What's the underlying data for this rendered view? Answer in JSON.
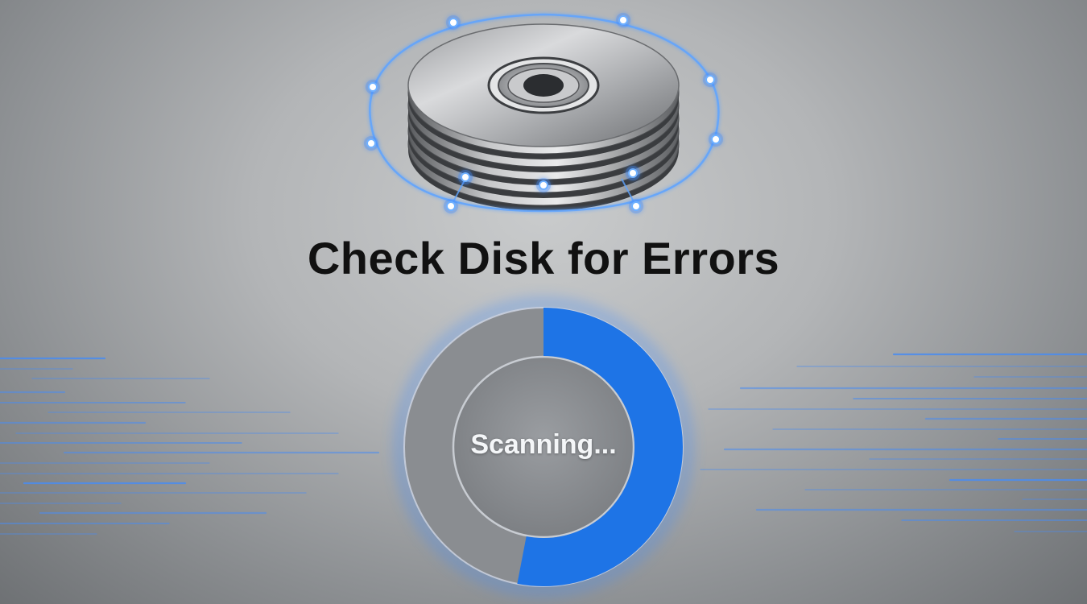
{
  "dialog": {
    "title": "Check Disk for Errors",
    "status": "Scanning..."
  },
  "progress": {
    "fraction": 0.53
  },
  "colors": {
    "accent": "#1e74e6",
    "title": "#111111",
    "status_text": "#f4f6f8"
  },
  "icons": [
    "disk-stack-icon",
    "orbit-ring-icon",
    "progress-ring"
  ]
}
